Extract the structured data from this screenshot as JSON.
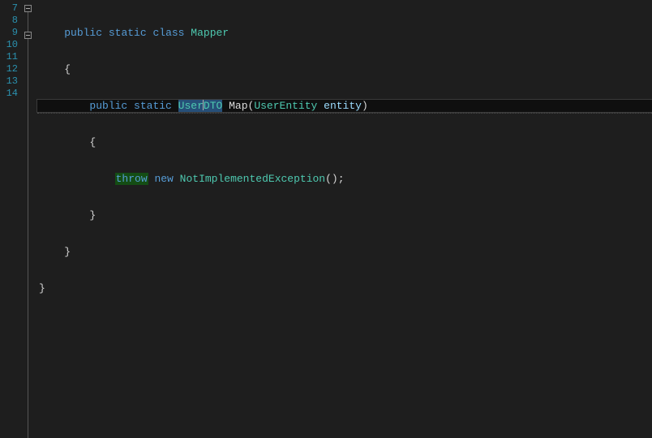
{
  "editor": {
    "line_numbers": [
      "7",
      "8",
      "9",
      "10",
      "11",
      "12",
      "13",
      "14"
    ],
    "fold_rows": [
      0,
      2
    ],
    "current_line_index": 2,
    "lines": {
      "l7": {
        "indent": "    ",
        "tokens": {
          "public": "public",
          "static": "static",
          "class": "class",
          "Mapper": "Mapper"
        }
      },
      "l8": {
        "indent": "    ",
        "brace": "{"
      },
      "l9": {
        "indent": "        ",
        "tokens": {
          "public": "public",
          "static": "static",
          "UserDTO_a": "User",
          "UserDTO_b": "DTO",
          "Map": "Map",
          "lparen": "(",
          "UserEntity": "UserEntity",
          "entity": "entity",
          "rparen": ")"
        }
      },
      "l10": {
        "indent": "        ",
        "brace": "{"
      },
      "l11": {
        "indent": "            ",
        "tokens": {
          "throw": "throw",
          "new": "new",
          "NotImplementedException": "NotImplementedException",
          "parens": "()",
          "semi": ";"
        }
      },
      "l12": {
        "indent": "        ",
        "brace": "}"
      },
      "l13": {
        "indent": "    ",
        "brace": "}"
      },
      "l14": {
        "indent": "",
        "brace": "}"
      }
    }
  }
}
